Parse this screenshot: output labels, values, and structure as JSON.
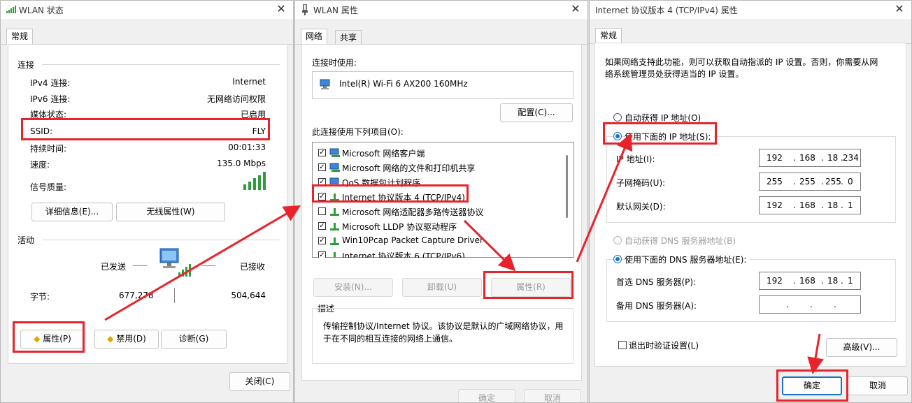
{
  "status_dialog": {
    "title": "WLAN 状态",
    "tab": "常规",
    "connection_section": "连接",
    "rows": [
      {
        "label": "IPv4 连接:",
        "value": "Internet"
      },
      {
        "label": "IPv6 连接:",
        "value": "无网络访问权限"
      },
      {
        "label": "媒体状态:",
        "value": "已启用"
      },
      {
        "label": "SSID:",
        "value": "FLY"
      },
      {
        "label": "持续时间:",
        "value": "00:01:33"
      },
      {
        "label": "速度:",
        "value": "135.0 Mbps"
      }
    ],
    "signal_label": "信号质量:",
    "details_button": "详细信息(E)...",
    "wireless_props_button": "无线属性(W)",
    "activity_section": "活动",
    "sent_label": "已发送",
    "received_label": "已接收",
    "bytes_label": "字节:",
    "bytes_sent": "677,278",
    "bytes_received": "504,644",
    "properties_button": "属性(P)",
    "disable_button": "禁用(D)",
    "diagnose_button": "诊断(G)",
    "close_button": "关闭(C)"
  },
  "props_dialog": {
    "title": "WLAN 属性",
    "tabs": [
      "网络",
      "共享"
    ],
    "connect_using_label": "连接时使用:",
    "adapter_name": "Intel(R) Wi-Fi 6 AX200 160MHz",
    "configure_button": "配置(C)...",
    "items_label": "此连接使用下列项目(O):",
    "items": [
      {
        "label": "Microsoft 网络客户端",
        "checked": true
      },
      {
        "label": "Microsoft 网络的文件和打印机共享",
        "checked": true
      },
      {
        "label": "QoS 数据包计划程序",
        "checked": true
      },
      {
        "label": "Internet 协议版本 4 (TCP/IPv4)",
        "checked": true
      },
      {
        "label": "Microsoft 网络适配器多路传送器协议",
        "checked": false
      },
      {
        "label": "Microsoft LLDP 协议驱动程序",
        "checked": true
      },
      {
        "label": "Win10Pcap Packet Capture Driver",
        "checked": true
      },
      {
        "label": "Internet 协议版本 6 (TCP/IPv6)",
        "checked": true
      }
    ],
    "install_button": "安装(N)...",
    "uninstall_button": "卸载(U)",
    "properties_button": "属性(R)",
    "description_label": "描述",
    "description_text_1": "传输控制协议/Internet 协议。该协议是默认的广域网络协议，用",
    "description_text_2": "于在不同的相互连接的网络上通信。",
    "ok_button": "确定",
    "cancel_button": "取消"
  },
  "ipv4_dialog": {
    "title": "Internet 协议版本 4 (TCP/IPv4) 属性",
    "tab": "常规",
    "intro_1": "如果网络支持此功能，则可以获取自动指派的 IP 设置。否则，你需要从网",
    "intro_2": "络系统管理员处获得适当的 IP 设置。",
    "auto_ip_label": "自动获得 IP 地址(O)",
    "manual_ip_label": "使用下面的 IP 地址(S):",
    "ip_label": "IP 地址(I):",
    "ip_value": [
      "192",
      "168",
      "18",
      "234"
    ],
    "mask_label": "子网掩码(U):",
    "mask_value": [
      "255",
      "255",
      "255",
      "0"
    ],
    "gateway_label": "默认网关(D):",
    "gateway_value": [
      "192",
      "168",
      "18",
      "1"
    ],
    "auto_dns_label": "自动获得 DNS 服务器地址(B)",
    "manual_dns_label": "使用下面的 DNS 服务器地址(E):",
    "preferred_dns_label": "首选 DNS 服务器(P):",
    "preferred_dns_value": [
      "192",
      "168",
      "18",
      "1"
    ],
    "alternate_dns_label": "备用 DNS 服务器(A):",
    "alternate_dns_value": [
      "",
      "",
      "",
      ""
    ],
    "validate_label": "退出时验证设置(L)",
    "advanced_button": "高级(V)...",
    "ok_button": "确定",
    "cancel_button": "取消"
  },
  "colors": {
    "highlight_red": "#e8232b",
    "accent_blue": "#1a73c9"
  }
}
